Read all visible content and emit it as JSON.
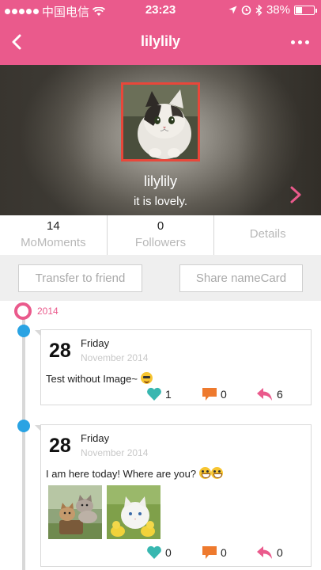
{
  "status_bar": {
    "carrier": "中国电信",
    "time": "23:23",
    "battery": "38%",
    "battery_fraction": 0.38,
    "signal_bars_filled": 5
  },
  "nav": {
    "title": "lilylily",
    "back_icon": "chevron-left-icon",
    "more_icon": "more-dots-icon"
  },
  "profile": {
    "name": "lilylily",
    "motto": "it is lovely.",
    "avatar_alt": "cat avatar"
  },
  "stats": {
    "moments_count": "14",
    "moments_label": "MoMoments",
    "followers_count": "0",
    "followers_label": "Followers",
    "details_label": "Details"
  },
  "actions": {
    "transfer_label": "Transfer to friend",
    "share_label": "Share nameCard"
  },
  "timeline": {
    "year": "2014",
    "posts": [
      {
        "day": "28",
        "weekday": "Friday",
        "month_year": "November 2014",
        "text": "Test without Image~",
        "likes": "1",
        "comments": "0",
        "shares": "6"
      },
      {
        "day": "28",
        "weekday": "Friday",
        "month_year": "November 2014",
        "text": "I am here today!  Where are you?",
        "likes": "0",
        "comments": "0",
        "shares": "0"
      }
    ]
  },
  "colors": {
    "brand_pink": "#ea5a8c",
    "timeline_blue": "#2aa3e3",
    "like_teal": "#38b7b0",
    "comment_orange": "#ee7a2e",
    "share_pink": "#ea5a8c",
    "avatar_border": "#e8473a"
  }
}
